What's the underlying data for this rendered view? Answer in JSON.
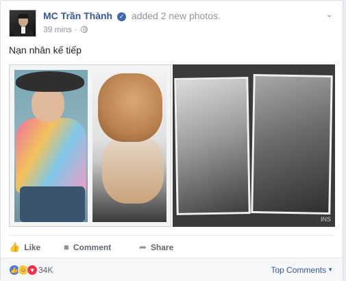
{
  "post": {
    "author": "MC Trần Thành",
    "action_text": "added 2 new photos.",
    "time": "39 mins ·",
    "text": "Nạn nhân kế tiếp",
    "photos_watermark": "INS"
  },
  "actions": {
    "like": "Like",
    "comment": "Comment",
    "share": "Share"
  },
  "reactions": {
    "count": "34K",
    "top_comments": "Top Comments"
  },
  "icons": {
    "verified": "verified-badge-icon",
    "privacy": "globe-icon",
    "menu": "chevron-down-icon",
    "like": "thumbs-up-icon",
    "comment": "speech-bubble-icon",
    "share": "share-arrow-icon"
  },
  "colors": {
    "link": "#365899",
    "verified": "#4267b2",
    "muted": "#90949c",
    "like_reaction": "#4a76e8",
    "haha_reaction": "#f7c843",
    "love_reaction": "#f0334f"
  }
}
